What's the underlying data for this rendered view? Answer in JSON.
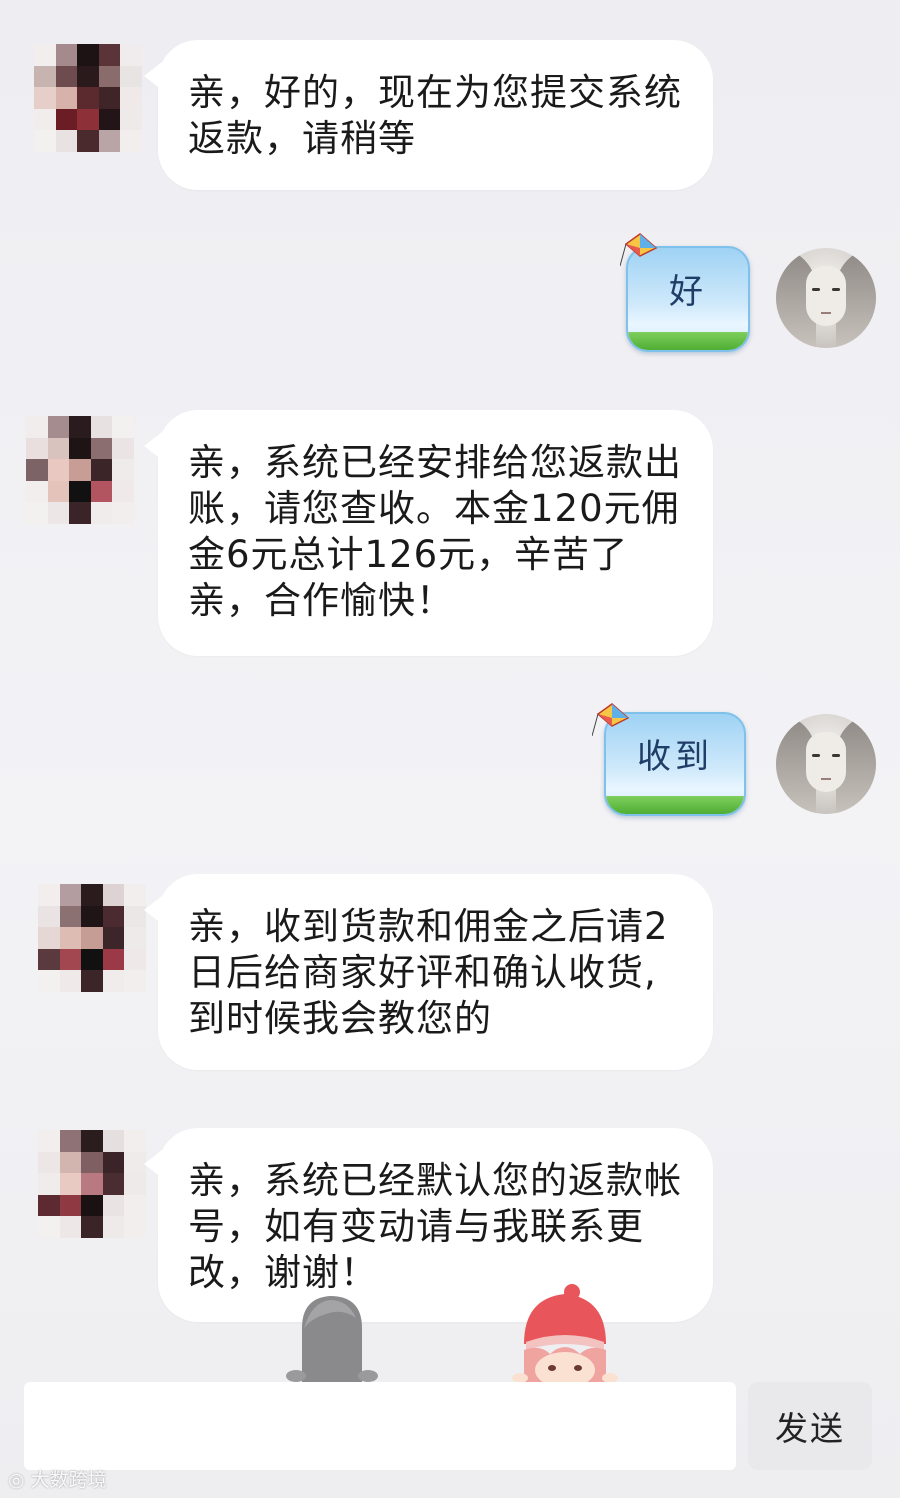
{
  "messages": [
    {
      "side": "in",
      "text": "亲，好的，现在为您提交系统返款，请稍等"
    },
    {
      "side": "out",
      "text": "好"
    },
    {
      "side": "in",
      "text": "亲，系统已经安排给您返款出账，请您查收。本金120元佣金6元总计126元，辛苦了亲，合作愉快！"
    },
    {
      "side": "out",
      "text": "收到"
    },
    {
      "side": "in",
      "text": "亲，收到货款和佣金之后请2日后给商家好评和确认收货,到时候我会教您的"
    },
    {
      "side": "in",
      "text": "亲，系统已经默认您的返款帐号，如有变动请与我联系更改，谢谢！"
    }
  ],
  "composer": {
    "input_value": "",
    "send_label": "发送"
  },
  "watermark": "大数跨境",
  "colors": {
    "incoming_bubble": "#ffffff",
    "kite_bubble_sky": "#9fd2f4",
    "kite_bubble_grass": "#4fae34",
    "background": "#efeff2"
  }
}
